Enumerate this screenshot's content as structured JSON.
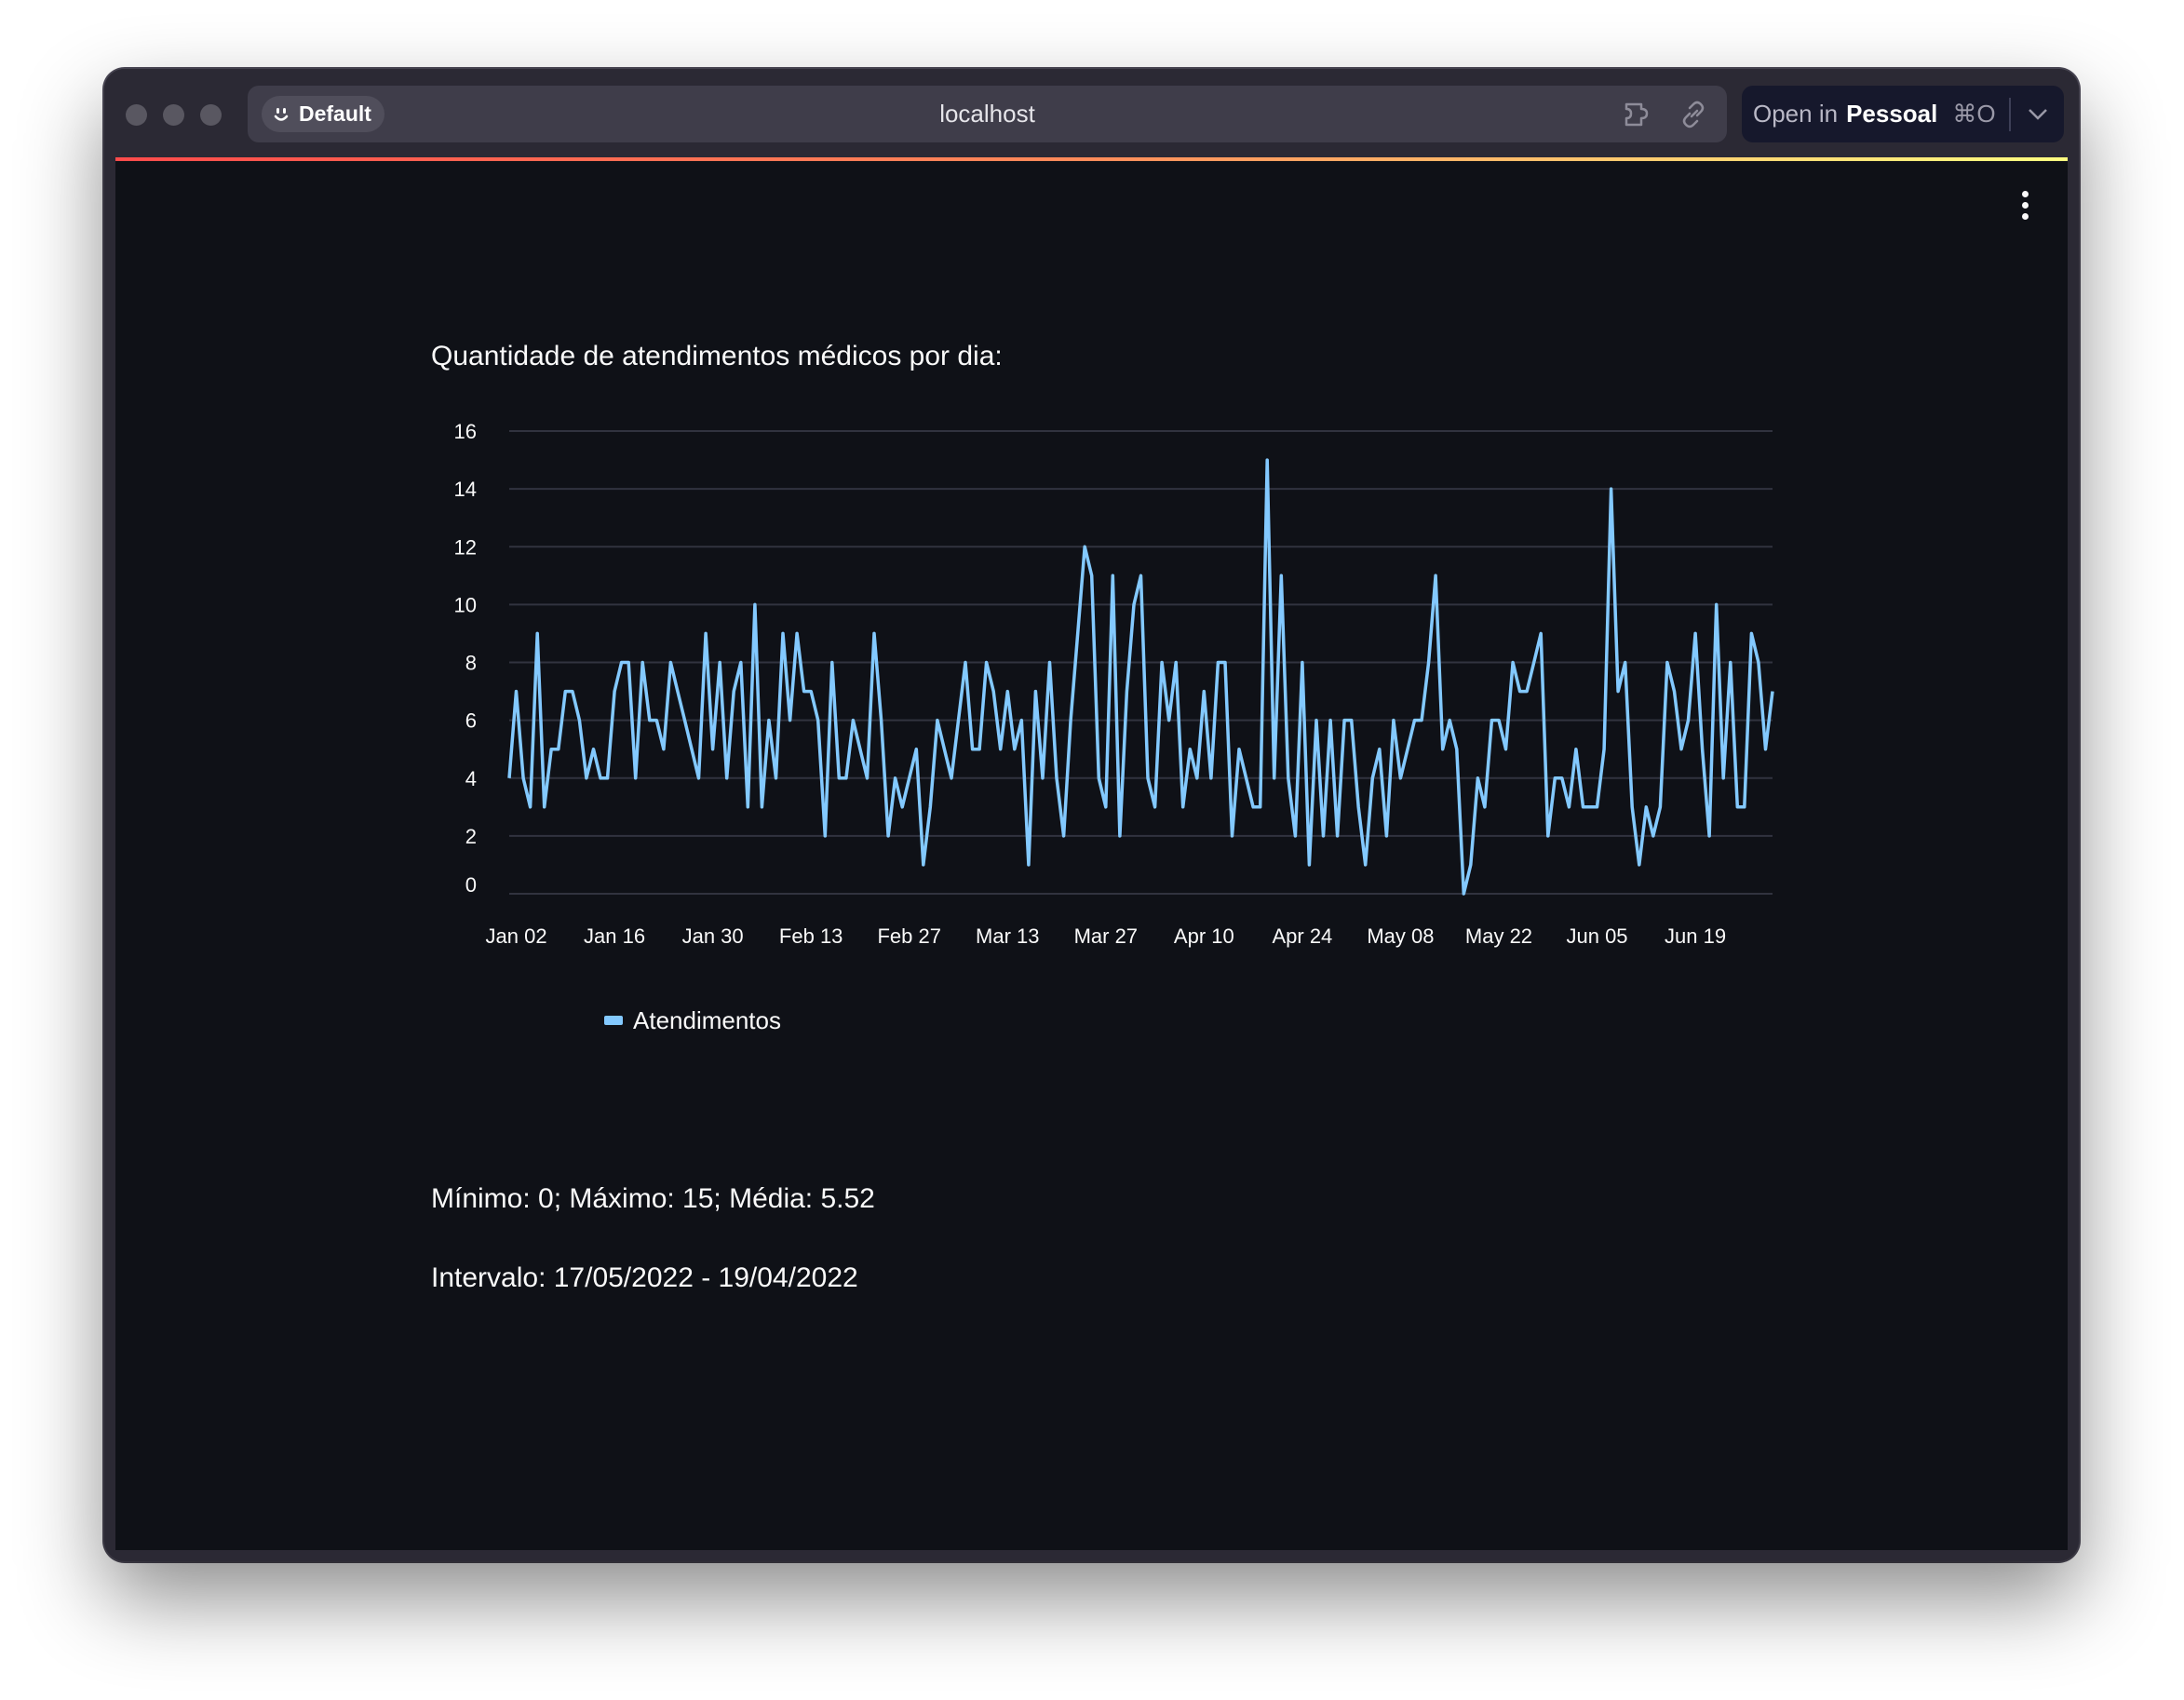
{
  "browser": {
    "profile_label": "Default",
    "url": "localhost",
    "open_in_prefix": "Open in",
    "open_in_target": "Pessoal",
    "open_in_shortcut": "⌘O"
  },
  "colors": {
    "background": "#0f1117",
    "series": "#83c9ff",
    "text": "#fafafa",
    "grid": "#31333f"
  },
  "page": {
    "chart_heading": "Quantidade de atendimentos médicos por dia:",
    "stats_line": "Mínimo: 0; Máximo: 15; Média: 5.52",
    "interval_line": "Intervalo: 17/05/2022 - 19/04/2022"
  },
  "chart_data": {
    "type": "line",
    "title": "",
    "xlabel": "",
    "ylabel": "",
    "x_start": "2022-01-01",
    "x_end": "2022-06-30",
    "x_step": "1 day",
    "x_ticks": [
      "Jan 02",
      "Jan 16",
      "Jan 30",
      "Feb 13",
      "Feb 27",
      "Mar 13",
      "Mar 27",
      "Apr 10",
      "Apr 24",
      "May 08",
      "May 22",
      "Jun 05",
      "Jun 19"
    ],
    "y_ticks": [
      0,
      2,
      4,
      6,
      8,
      10,
      12,
      14,
      16
    ],
    "ylim": [
      0,
      16
    ],
    "grid": true,
    "legend_position": "bottom-left",
    "series": [
      {
        "name": "Atendimentos",
        "values": [
          4,
          7,
          4,
          3,
          9,
          3,
          5,
          5,
          7,
          7,
          6,
          4,
          5,
          4,
          4,
          7,
          8,
          8,
          4,
          8,
          6,
          6,
          5,
          8,
          7,
          6,
          5,
          4,
          9,
          5,
          8,
          4,
          7,
          8,
          3,
          10,
          3,
          6,
          4,
          9,
          6,
          9,
          7,
          7,
          6,
          2,
          8,
          4,
          4,
          6,
          5,
          4,
          9,
          6,
          2,
          4,
          3,
          4,
          5,
          1,
          3,
          6,
          5,
          4,
          6,
          8,
          5,
          5,
          8,
          7,
          5,
          7,
          5,
          6,
          1,
          7,
          4,
          8,
          4,
          2,
          6,
          9,
          12,
          11,
          4,
          3,
          11,
          2,
          7,
          10,
          11,
          4,
          3,
          8,
          6,
          8,
          3,
          5,
          4,
          7,
          4,
          8,
          8,
          2,
          5,
          4,
          3,
          3,
          15,
          4,
          11,
          4,
          2,
          8,
          1,
          6,
          2,
          6,
          2,
          6,
          6,
          3,
          1,
          4,
          5,
          2,
          6,
          4,
          5,
          6,
          6,
          8,
          11,
          5,
          6,
          5,
          0,
          1,
          4,
          3,
          6,
          6,
          5,
          8,
          7,
          7,
          8,
          9,
          2,
          4,
          4,
          3,
          5,
          3,
          3,
          3,
          5,
          14,
          7,
          8,
          3,
          1,
          3,
          2,
          3,
          8,
          7,
          5,
          6,
          9,
          5,
          2,
          10,
          4,
          8,
          3,
          3,
          9,
          8,
          5,
          7
        ]
      }
    ]
  }
}
